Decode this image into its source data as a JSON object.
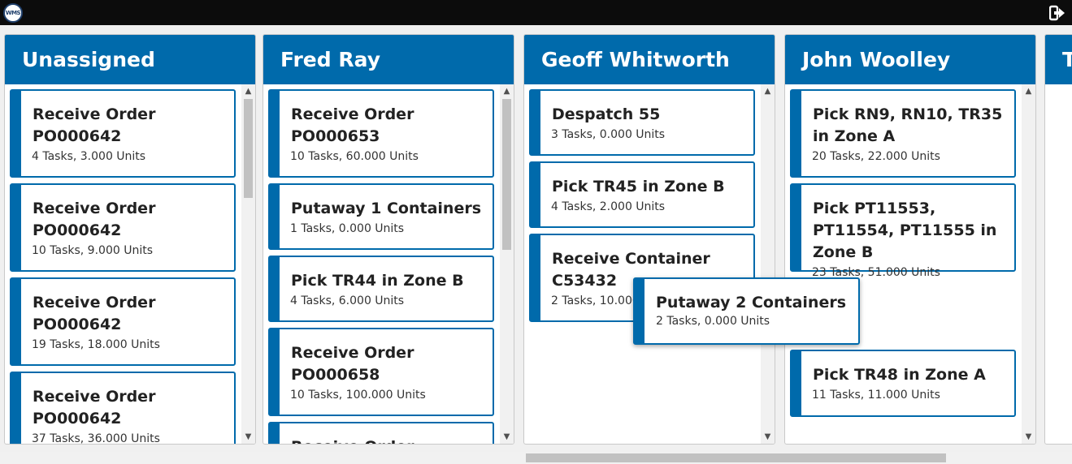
{
  "app": {
    "logo_text": "WMS"
  },
  "icons": {
    "logout": "logout-icon",
    "scroll_up": "chevron-up-icon",
    "scroll_down": "chevron-down-icon"
  },
  "colors": {
    "accent": "#006aab",
    "topbar": "#0c0c0c"
  },
  "columns": [
    {
      "name": "Unassigned",
      "cards": [
        {
          "title": "Receive Order PO000642",
          "sub": "4 Tasks, 3.000 Units"
        },
        {
          "title": "Receive Order PO000642",
          "sub": "10 Tasks, 9.000 Units"
        },
        {
          "title": "Receive Order PO000642",
          "sub": "19 Tasks, 18.000 Units"
        },
        {
          "title": "Receive Order PO000642",
          "sub": "37 Tasks, 36.000 Units"
        }
      ]
    },
    {
      "name": "Fred Ray",
      "cards": [
        {
          "title": "Receive Order PO000653",
          "sub": "10 Tasks, 60.000 Units"
        },
        {
          "title": "Putaway 1 Containers",
          "sub": "1 Tasks, 0.000 Units"
        },
        {
          "title": "Pick TR44 in Zone B",
          "sub": "4 Tasks, 6.000 Units"
        },
        {
          "title": "Receive Order PO000658",
          "sub": "10 Tasks, 100.000 Units"
        },
        {
          "title": "Receive Order",
          "sub": ""
        }
      ]
    },
    {
      "name": "Geoff Whitworth",
      "cards": [
        {
          "title": "Despatch 55",
          "sub": "3 Tasks, 0.000 Units"
        },
        {
          "title": "Pick TR45 in Zone B",
          "sub": "4 Tasks, 2.000 Units"
        },
        {
          "title": "Receive Container C53432",
          "sub": "2 Tasks, 10.000 Units"
        }
      ]
    },
    {
      "name": "John Woolley",
      "cards": [
        {
          "title": "Pick RN9, RN10, TR35 in Zone A",
          "sub": "20 Tasks, 22.000 Units"
        },
        {
          "title": "Pick PT11553, PT11554, PT11555 in Zone B",
          "sub": "23 Tasks, 51.000 Units"
        },
        {
          "title": "Pick TR48 in Zone A",
          "sub": "11 Tasks, 11.000 Units"
        }
      ]
    },
    {
      "name": "T",
      "cards": []
    }
  ],
  "dragging_card": {
    "title": "Putaway 2 Containers",
    "sub": "2 Tasks, 0.000 Units"
  }
}
